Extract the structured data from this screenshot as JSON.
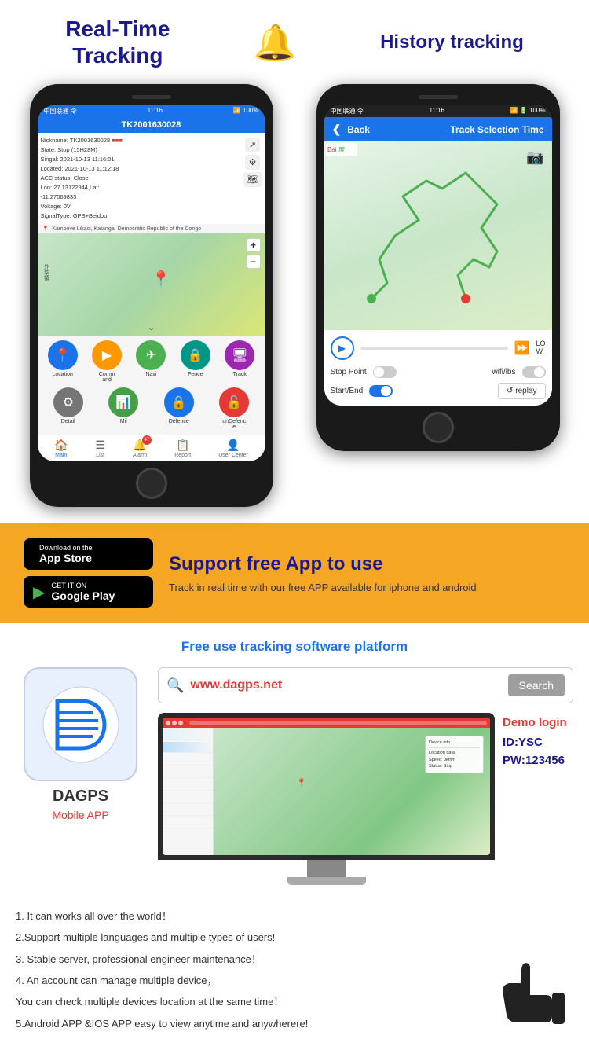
{
  "header": {
    "left_title_line1": "Real-Time",
    "left_title_line2": "Tracking",
    "right_title": "History tracking",
    "bell_icon": "🔔"
  },
  "phone1": {
    "status": "中国联通 令",
    "time": "11:16",
    "battery": "100%",
    "device_id": "TK2001630028",
    "info_lines": [
      "Nickname: TK2001630028",
      "State: Stop (15H28M)",
      "Singal: 2021-10-13 11:16:01",
      "Located: 2021-10-13 11:12:18",
      "ACC status: Close",
      "Lon: 27.13122944,Lat:",
      "-11.27069833",
      "Voltage: 0V",
      "SignalType: GPS+Beidou"
    ],
    "location": "Kambove Likasi, Katanga, Democratic Republic of the Congo",
    "actions": [
      {
        "label": "Location",
        "icon": "📍",
        "color": "blue"
      },
      {
        "label": "Command",
        "icon": "▶",
        "color": "orange"
      },
      {
        "label": "Navi",
        "icon": "✈",
        "color": "green"
      },
      {
        "label": "Fence",
        "icon": "🔒",
        "color": "teal"
      },
      {
        "label": "Track",
        "icon": "🖥",
        "color": "purple"
      }
    ],
    "actions2": [
      {
        "label": "Detail",
        "icon": "⚙",
        "color": "grey"
      },
      {
        "label": "Mil",
        "icon": "📊",
        "color": "green"
      },
      {
        "label": "Defence",
        "icon": "🔒",
        "color": "blue"
      },
      {
        "label": "unDefence",
        "icon": "🔓",
        "color": "red"
      }
    ],
    "nav_items": [
      {
        "label": "Main",
        "icon": "🏠",
        "active": true
      },
      {
        "label": "List",
        "icon": "☰",
        "active": false
      },
      {
        "label": "Alarm",
        "icon": "🔔",
        "active": false,
        "badge": "47"
      },
      {
        "label": "Report",
        "icon": "📋",
        "active": false
      },
      {
        "label": "User Center",
        "icon": "👤",
        "active": false
      }
    ]
  },
  "phone2": {
    "status": "中国联通 令",
    "time": "11:16",
    "battery": "100%",
    "back_label": "Back",
    "header_title": "Track Selection Time",
    "playback": {
      "play_icon": "▶",
      "speed": "LO W"
    },
    "stop_point_label": "Stop Point",
    "wifi_lbs_label": "wifi/lbs",
    "start_end_label": "Start/End",
    "replay_label": "↺ replay"
  },
  "banner": {
    "appstore_small": "Download on the",
    "appstore_big": "App Store",
    "googleplay_small": "GET IT ON",
    "googleplay_big": "Google Play",
    "support_title": "Support free App to use",
    "support_desc": "Track in real time with our free APP available for iphone and android"
  },
  "platform": {
    "title": "Free use tracking software platform",
    "app_name": "DAGPS",
    "mobile_app_label": "Mobile APP",
    "search_url": "www.dagps.net",
    "search_btn": "Search",
    "search_placeholder": "www.dagps.net",
    "demo_title": "Demo login",
    "demo_id": "ID:YSC",
    "demo_pw": "PW:123456"
  },
  "features": {
    "items": [
      "1. It can works all over the world！",
      "2.Support multiple languages and multiple types of users!",
      "3. Stable server, professional engineer maintenance！",
      "4. An account can manage multiple device，",
      "You can check multiple devices location at the same time！",
      "5.Android APP &IOS APP easy to view anytime and anywherere!"
    ]
  }
}
